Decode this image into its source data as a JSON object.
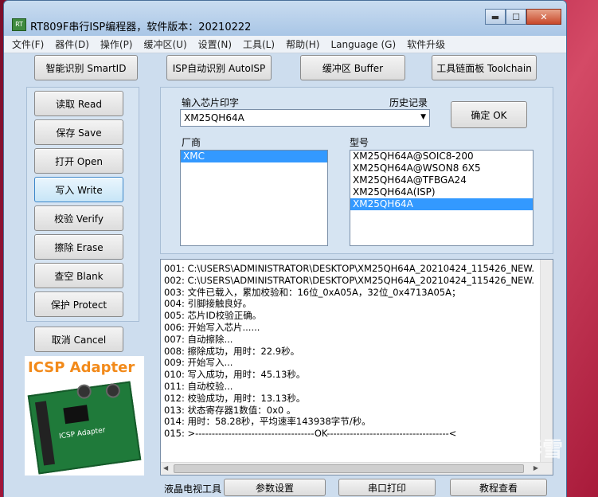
{
  "window": {
    "title": "RT809F串行ISP编程器，软件版本：20210222",
    "icon_text": "RT"
  },
  "menu": [
    "文件(F)",
    "器件(D)",
    "操作(P)",
    "缓冲区(U)",
    "设置(N)",
    "工具(L)",
    "帮助(H)",
    "Language (G)",
    "软件升级"
  ],
  "top_buttons": {
    "smartid": "智能识别 SmartID",
    "autoisp": "ISP自动识别 AutoISP",
    "buffer": "缓冲区 Buffer",
    "toolchain": "工具链面板 Toolchain"
  },
  "side_buttons": {
    "read": "读取 Read",
    "save": "保存 Save",
    "open": "打开 Open",
    "write": "写入 Write",
    "verify": "校验 Verify",
    "erase": "擦除 Erase",
    "blank": "查空 Blank",
    "protect": "保护 Protect",
    "cancel": "取消 Cancel"
  },
  "chip_input": {
    "label": "输入芯片印字",
    "history_label": "历史记录",
    "value": "XM25QH64A",
    "ok_button": "确定 OK"
  },
  "vendor": {
    "label": "厂商",
    "items": [
      "XMC"
    ],
    "selected": "XMC"
  },
  "model": {
    "label": "型号",
    "items": [
      "XM25QH64A@SOIC8-200",
      "XM25QH64A@WSON8 6X5",
      "XM25QH64A@TFBGA24",
      "XM25QH64A(ISP)",
      "XM25QH64A"
    ],
    "selected": "XM25QH64A"
  },
  "log": [
    "001:  C:\\USERS\\ADMINISTRATOR\\DESKTOP\\XM25QH64A_20210424_115426_NEW.",
    "002:  C:\\USERS\\ADMINISTRATOR\\DESKTOP\\XM25QH64A_20210424_115426_NEW.",
    "003:  文件已载入，累加校验和：16位_0xA05A，32位_0x4713A05A；",
    "004:  引脚接触良好。",
    "005:  芯片ID校验正确。",
    "006:  开始写入芯片......",
    "007:  自动擦除...",
    "008:  擦除成功，用时：22.9秒。",
    "009:  开始写入...",
    "010:  写入成功，用时：45.13秒。",
    "011:  自动校验...",
    "012:  校验成功，用时：13.13秒。",
    "013:  状态寄存器1数值：0x0 。",
    "014:  用时：58.28秒，平均速率143938字节/秒。",
    "015:  >------------------------------------OK-------------------------------------<"
  ],
  "adapter": {
    "title": "ICSP Adapter",
    "board_label": "ICSP Adapter"
  },
  "bottom": {
    "lcd_tool": "液晶电视工具",
    "params_button": "参数设置",
    "serial_button": "串口打印",
    "tutorial_button": "教程查看"
  },
  "watermark": "春雪",
  "colors": {
    "selection": "#3399ff",
    "adapter_title": "#f28a1a",
    "window_bg": "#cdddee"
  }
}
